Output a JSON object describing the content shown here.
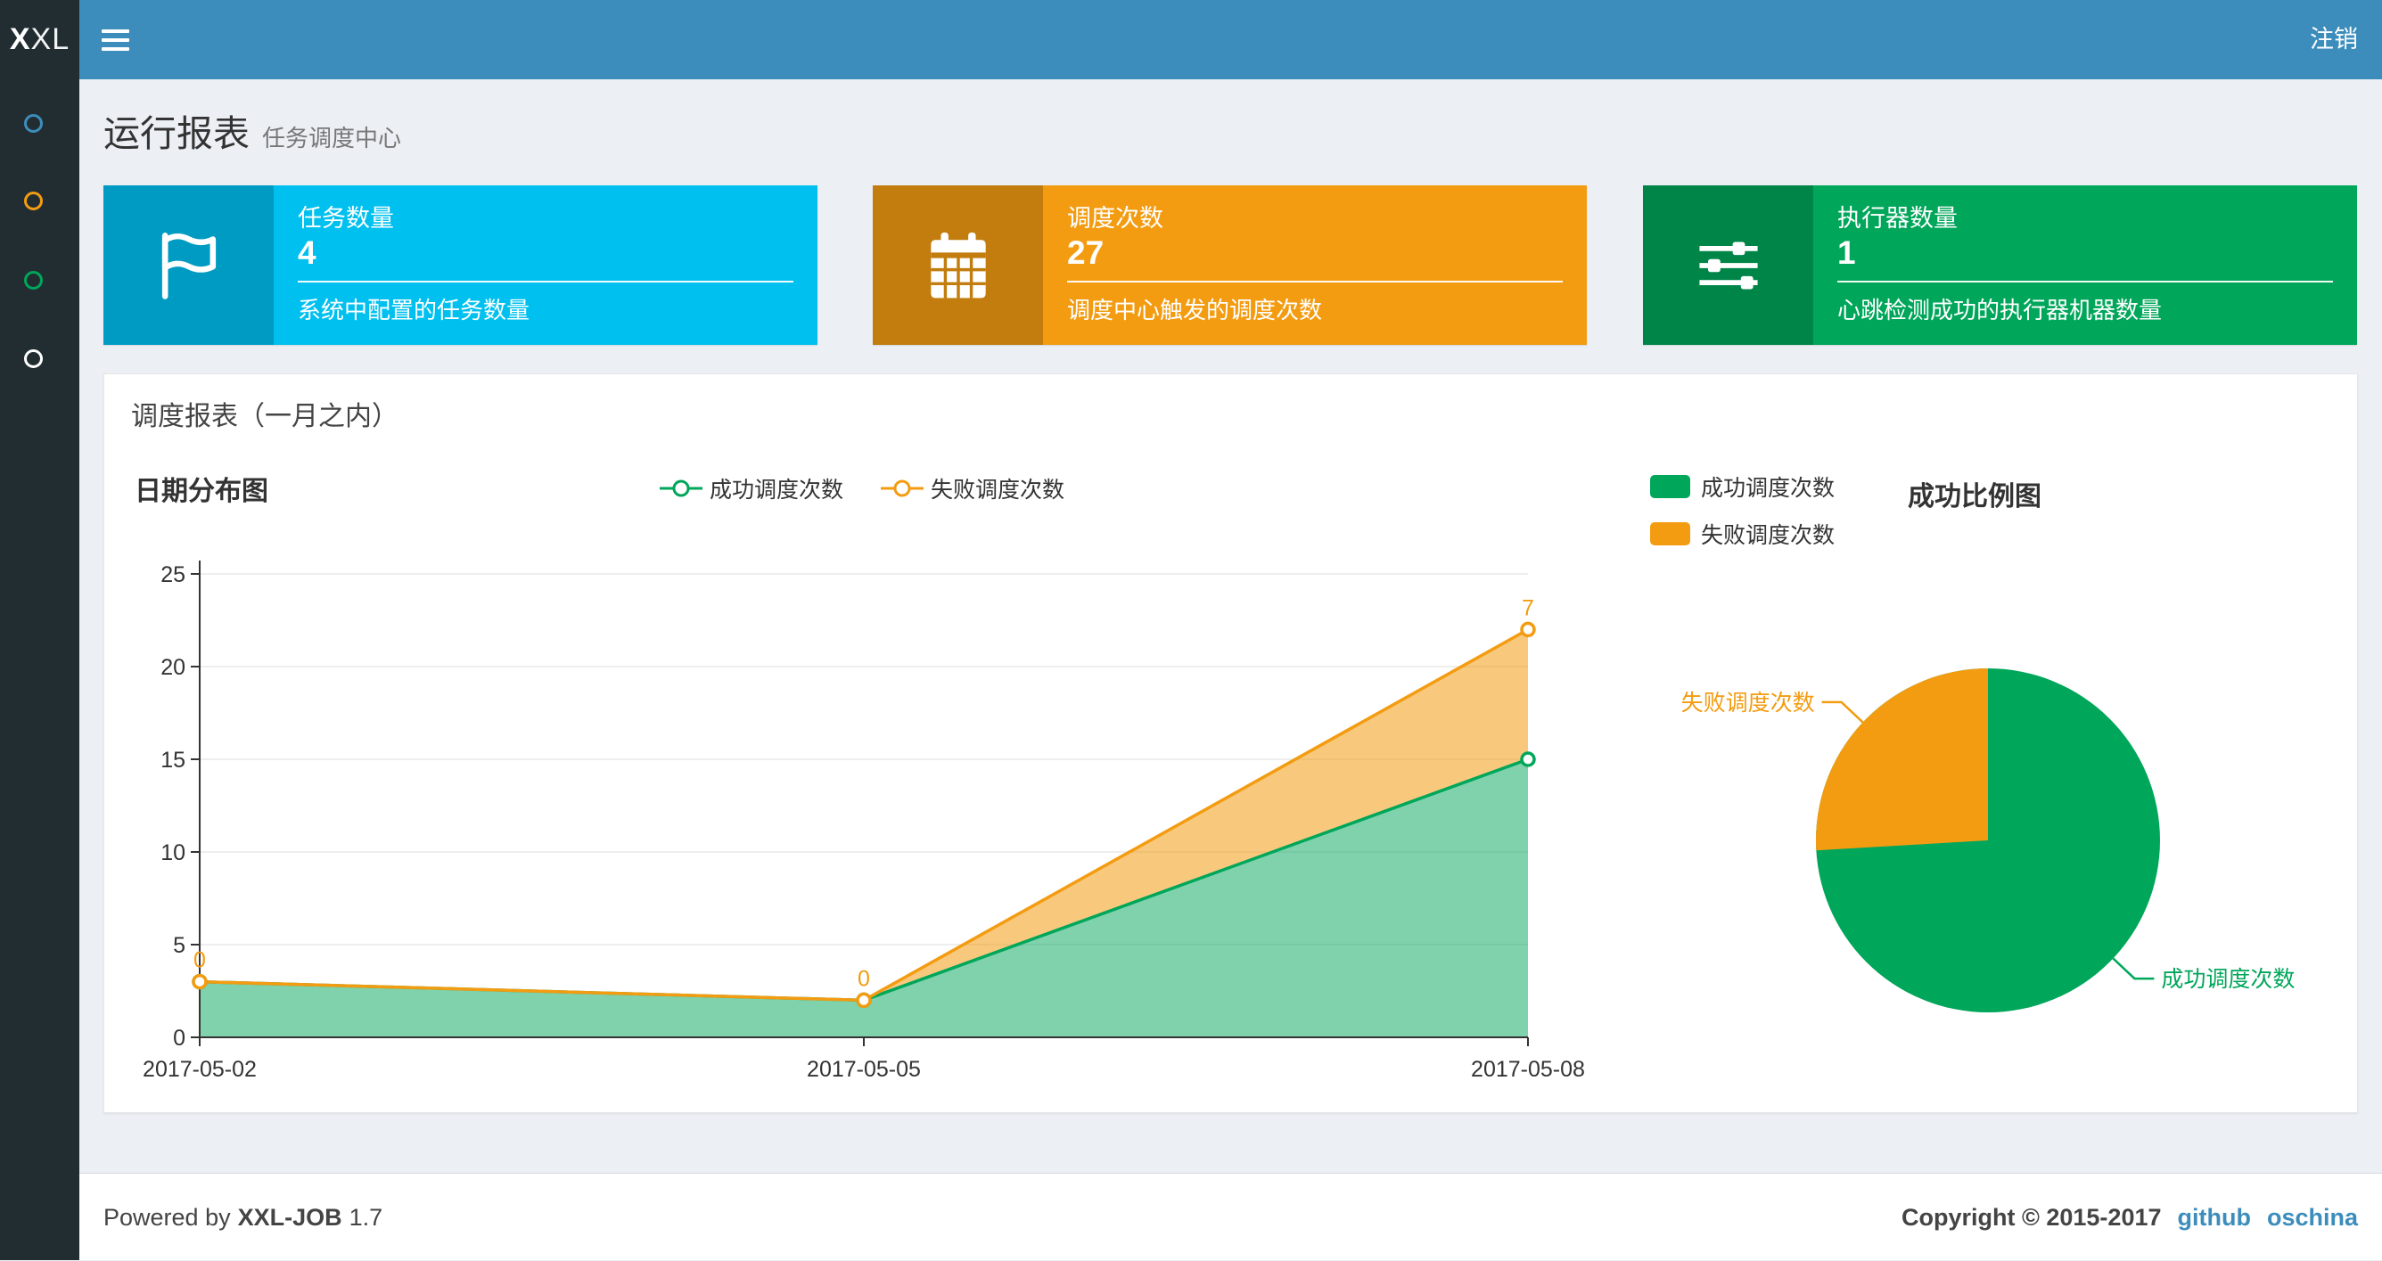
{
  "navbar": {
    "logo_bold": "X",
    "logo_light": "XL",
    "logout_label": "注销",
    "bg_color": "#3c8dbc",
    "logo_bg_color": "#222d32"
  },
  "sidebar": {
    "bg_color": "#222d32",
    "items": [
      {
        "name": "menu-item-1",
        "color": "#3c8dbc"
      },
      {
        "name": "menu-item-2",
        "color": "#f39c12"
      },
      {
        "name": "menu-item-3",
        "color": "#00a65a"
      },
      {
        "name": "menu-item-4",
        "color": "#ffffff"
      }
    ]
  },
  "page": {
    "title": "运行报表",
    "subtitle": "任务调度中心"
  },
  "info_boxes": [
    {
      "icon": "flag-icon",
      "title": "任务数量",
      "value": "4",
      "desc": "系统中配置的任务数量",
      "body_color": "#00c0ef",
      "icon_color": "#009bc2"
    },
    {
      "icon": "calendar-icon",
      "title": "调度次数",
      "value": "27",
      "desc": "调度中心触发的调度次数",
      "body_color": "#f39c12",
      "icon_color": "#c27d0e"
    },
    {
      "icon": "sliders-icon",
      "title": "执行器数量",
      "value": "1",
      "desc": "心跳检测成功的执行器机器数量",
      "body_color": "#00a65a",
      "icon_color": "#008548"
    }
  ],
  "panel": {
    "title": "调度报表（一月之内）"
  },
  "chart_data": [
    {
      "type": "area",
      "title": "日期分布图",
      "x": [
        "2017-05-02",
        "2017-05-05",
        "2017-05-08"
      ],
      "series": [
        {
          "name": "成功调度次数",
          "values": [
            3,
            2,
            15
          ],
          "color": "#00a65a"
        },
        {
          "name": "失败调度次数",
          "values": [
            0,
            0,
            7
          ],
          "color": "#f39c12"
        }
      ],
      "stacked": true,
      "point_labels": [
        "0",
        "0",
        "7"
      ],
      "ylim": [
        0,
        25
      ],
      "yticks": [
        0,
        5,
        10,
        15,
        20,
        25
      ],
      "legend_position": "top-center",
      "grid": true
    },
    {
      "type": "pie",
      "title": "成功比例图",
      "slices": [
        {
          "name": "成功调度次数",
          "value": 20,
          "color": "#00a65a"
        },
        {
          "name": "失败调度次数",
          "value": 7,
          "color": "#f39c12"
        }
      ],
      "start_angle": 90,
      "clockwise": true,
      "legend_position": "top-left"
    }
  ],
  "footer": {
    "powered_prefix": "Powered by",
    "product": "XXL-JOB",
    "version": "1.7",
    "copyright": "Copyright © 2015-2017",
    "links": [
      {
        "label": "github"
      },
      {
        "label": "oschina"
      }
    ]
  }
}
